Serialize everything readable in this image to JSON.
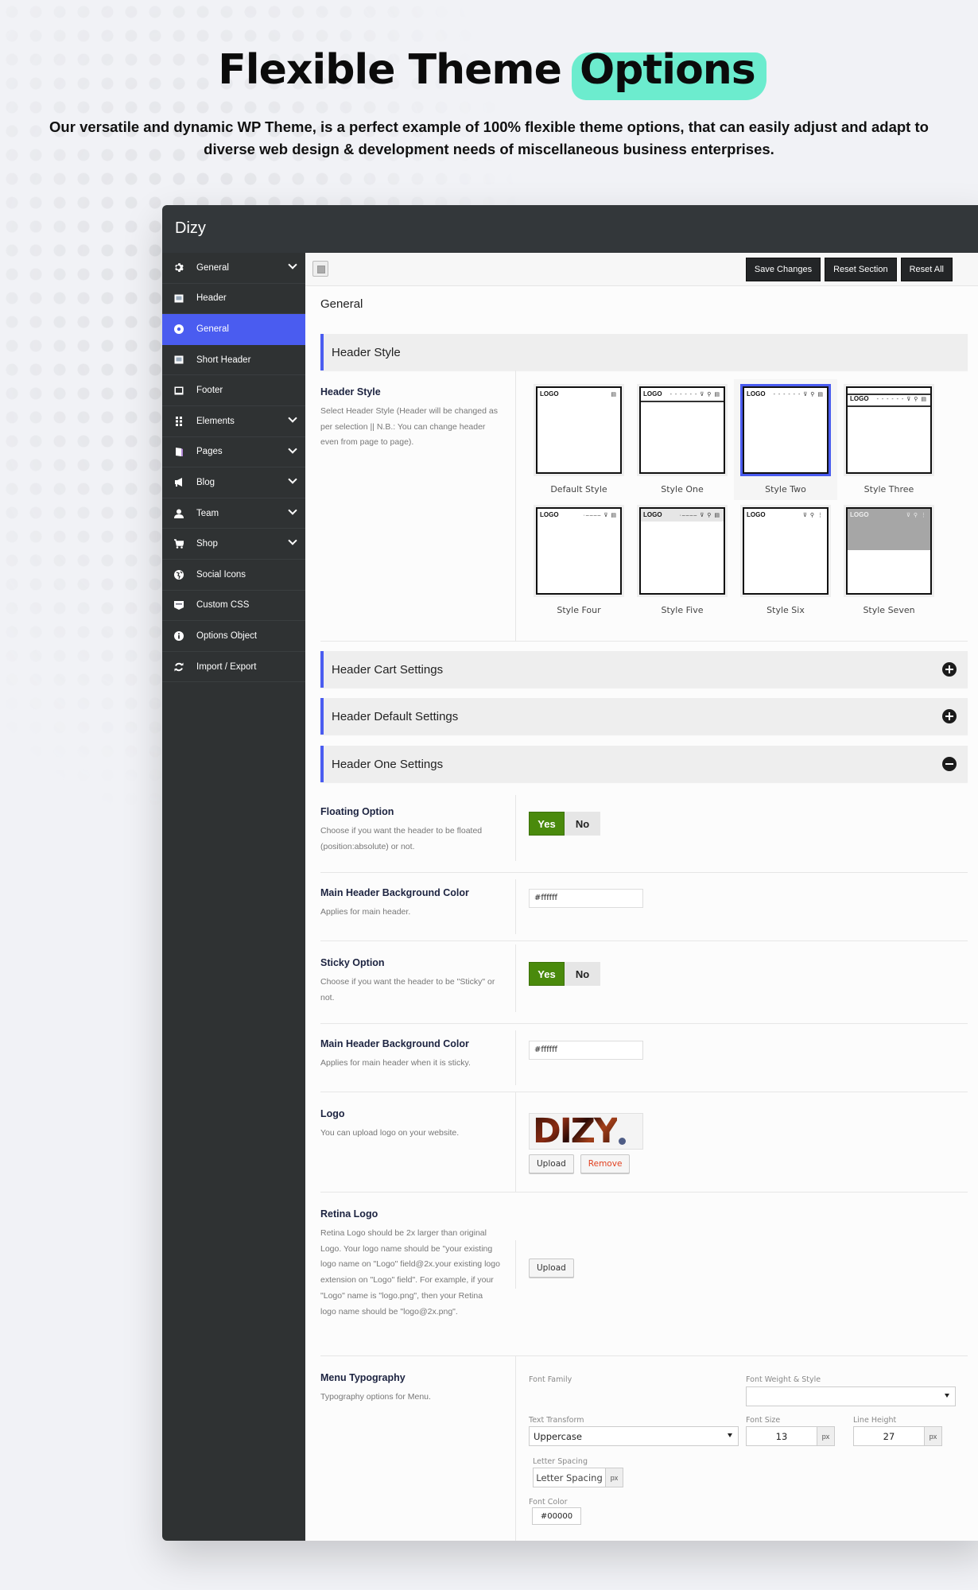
{
  "hero": {
    "title_main": "Flexible Theme",
    "title_highlight": "Options",
    "subtitle": "Our versatile and dynamic WP Theme, is a perfect example of 100% flexible theme options, that can easily adjust and adapt to diverse web design & development needs of miscellaneous business enterprises.",
    "highlight_color": "#6cecce"
  },
  "app": {
    "title": "Dizy",
    "accent_color": "#4a5cf0"
  },
  "sidebar": {
    "items": [
      {
        "label": "General",
        "icon": "gear-icon",
        "expandable": true,
        "active": false
      },
      {
        "label": "Header",
        "icon": "window-icon",
        "expandable": false,
        "active": false
      },
      {
        "label": "General",
        "icon": "circle-dot-icon",
        "expandable": false,
        "active": true
      },
      {
        "label": "Short Header",
        "icon": "window-icon",
        "expandable": false,
        "active": false
      },
      {
        "label": "Footer",
        "icon": "monitor-icon",
        "expandable": false,
        "active": false
      },
      {
        "label": "Elements",
        "icon": "grid-dots-icon",
        "expandable": true,
        "active": false
      },
      {
        "label": "Pages",
        "icon": "pages-icon",
        "expandable": true,
        "active": false
      },
      {
        "label": "Blog",
        "icon": "megaphone-icon",
        "expandable": true,
        "active": false
      },
      {
        "label": "Team",
        "icon": "user-icon",
        "expandable": true,
        "active": false
      },
      {
        "label": "Shop",
        "icon": "cart-icon",
        "expandable": true,
        "active": false
      },
      {
        "label": "Social Icons",
        "icon": "globe-icon",
        "expandable": false,
        "active": false
      },
      {
        "label": "Custom CSS",
        "icon": "css-icon",
        "expandable": false,
        "active": false
      },
      {
        "label": "Options Object",
        "icon": "info-icon",
        "expandable": false,
        "active": false
      },
      {
        "label": "Import / Export",
        "icon": "sync-icon",
        "expandable": false,
        "active": false
      }
    ]
  },
  "toolbar": {
    "save_label": "Save Changes",
    "reset_section_label": "Reset Section",
    "reset_all_label": "Reset All"
  },
  "main": {
    "section_title": "General",
    "header_style_bar": "Header Style",
    "header_style": {
      "title": "Header Style",
      "desc": "Select Header Style (Header will be changed as per selection || N.B.: You can change header even from page to page).",
      "selected": "Style Two",
      "options": [
        {
          "label": "Default Style",
          "logo": "LOGO"
        },
        {
          "label": "Style One",
          "logo": "LOGO"
        },
        {
          "label": "Style Two",
          "logo": "LOGO"
        },
        {
          "label": "Style Three",
          "logo": "LOGO"
        },
        {
          "label": "Style Four",
          "logo": "LOGO"
        },
        {
          "label": "Style Five",
          "logo": "LOGO"
        },
        {
          "label": "Style Six",
          "logo": "LOGO"
        },
        {
          "label": "Style Seven",
          "logo": "LOGO"
        }
      ]
    },
    "collapsibles": [
      {
        "label": "Header Cart Settings",
        "state": "collapsed"
      },
      {
        "label": "Header Default Settings",
        "state": "collapsed"
      },
      {
        "label": "Header One Settings",
        "state": "expanded"
      }
    ],
    "floating": {
      "title": "Floating Option",
      "desc": "Choose if you want the header to be floated (position:absolute) or not.",
      "yes": "Yes",
      "no": "No",
      "value": "Yes"
    },
    "main_bg": {
      "title": "Main Header Background Color",
      "desc": "Applies for main header.",
      "value": "#ffffff"
    },
    "sticky": {
      "title": "Sticky Option",
      "desc": "Choose if you want the header to be \"Sticky\" or not.",
      "yes": "Yes",
      "no": "No",
      "value": "Yes"
    },
    "sticky_bg": {
      "title": "Main Header Background Color",
      "desc": "Applies for main header when it is sticky.",
      "value": "#ffffff"
    },
    "logo": {
      "title": "Logo",
      "desc": "You can upload logo on your website.",
      "image_text": "DIZY",
      "upload_label": "Upload",
      "remove_label": "Remove"
    },
    "retina_logo": {
      "title": "Retina Logo",
      "desc": "Retina Logo should be 2x larger than original Logo. Your logo name should be \"your existing logo name on \"Logo\" field@2x.your existing logo extension on \"Logo\" field\". For example, if your \"Logo\" name is \"logo.png\", then your Retina logo name should be \"logo@2x.png\".",
      "upload_label": "Upload"
    },
    "typography": {
      "title": "Menu Typography",
      "desc": "Typography options for Menu.",
      "font_family_label": "Font Family",
      "font_weight_label": "Font Weight & Style",
      "font_weight_value": "",
      "text_transform_label": "Text Transform",
      "text_transform_value": "Uppercase",
      "font_size_label": "Font Size",
      "font_size_value": "13",
      "line_height_label": "Line Height",
      "line_height_value": "27",
      "unit": "px",
      "letter_spacing_label": "Letter Spacing",
      "letter_spacing_placeholder": "Letter Spacing",
      "font_color_label": "Font Color",
      "font_color_value": "#00000"
    }
  }
}
